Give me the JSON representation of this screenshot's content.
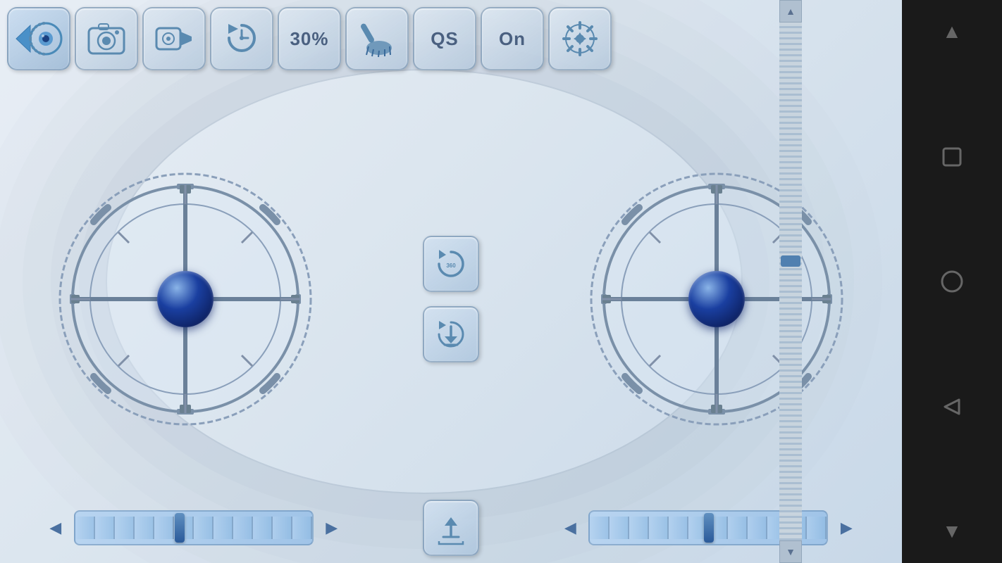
{
  "toolbar": {
    "buttons": [
      {
        "id": "eye",
        "label": "eye",
        "icon": "eye"
      },
      {
        "id": "camera",
        "label": "camera",
        "icon": "camera"
      },
      {
        "id": "video",
        "label": "video",
        "icon": "video"
      },
      {
        "id": "refresh",
        "label": "refresh",
        "icon": "refresh"
      },
      {
        "id": "speed",
        "label": "30%",
        "icon": "speed"
      },
      {
        "id": "brush",
        "label": "brush",
        "icon": "brush"
      },
      {
        "id": "qs",
        "label": "QS",
        "icon": "qs"
      },
      {
        "id": "on",
        "label": "On",
        "icon": "on"
      },
      {
        "id": "settings",
        "label": "settings",
        "icon": "settings"
      }
    ]
  },
  "joystick_left": {
    "id": "left-joystick",
    "label": "Left Joystick"
  },
  "joystick_right": {
    "id": "right-joystick",
    "label": "Right Joystick"
  },
  "center_buttons": [
    {
      "id": "rotate",
      "label": "rotate",
      "icon": "rotate"
    },
    {
      "id": "download",
      "label": "download",
      "icon": "download"
    }
  ],
  "bottom_center_button": {
    "id": "upload",
    "label": "upload",
    "icon": "upload"
  },
  "sliders": [
    {
      "id": "slider-left",
      "value": 45
    },
    {
      "id": "slider-right",
      "value": 50
    }
  ],
  "android_nav": {
    "buttons": [
      {
        "id": "nav-up",
        "label": "▲"
      },
      {
        "id": "nav-home",
        "label": "○"
      },
      {
        "id": "nav-back",
        "label": "◁"
      },
      {
        "id": "nav-down",
        "label": "▼"
      }
    ]
  },
  "colors": {
    "accent": "#4a70a0",
    "bg": "#dce8f2",
    "joystick_ball": "#1a3fa0",
    "ring": "#7a90a8"
  }
}
